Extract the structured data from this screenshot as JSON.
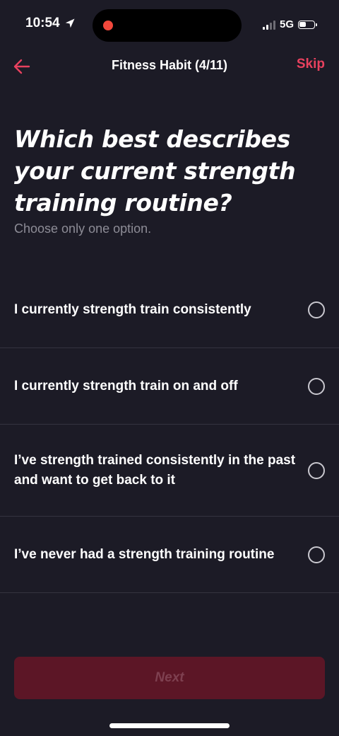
{
  "status_bar": {
    "time": "10:54",
    "network": "5G",
    "battery_level": 0.45
  },
  "nav": {
    "title": "Fitness Habit (4/11)",
    "skip_label": "Skip"
  },
  "question": {
    "title": "Which best describes your current strength training routine?",
    "hint": "Choose only one option."
  },
  "options": [
    {
      "label": "I currently strength train consistently",
      "selected": false
    },
    {
      "label": "I currently strength train on and off",
      "selected": false
    },
    {
      "label": "I’ve strength trained consistently in the past and want to get back to it",
      "selected": false
    },
    {
      "label": "I’ve never had a strength training routine",
      "selected": false
    }
  ],
  "next_button": {
    "label": "Next",
    "enabled": false
  },
  "colors": {
    "background": "#1c1b26",
    "accent": "#e8415e",
    "button_disabled_bg": "#5c1626",
    "button_disabled_text": "#7e4050",
    "divider": "#34333f",
    "hint_text": "#8d8c96"
  }
}
